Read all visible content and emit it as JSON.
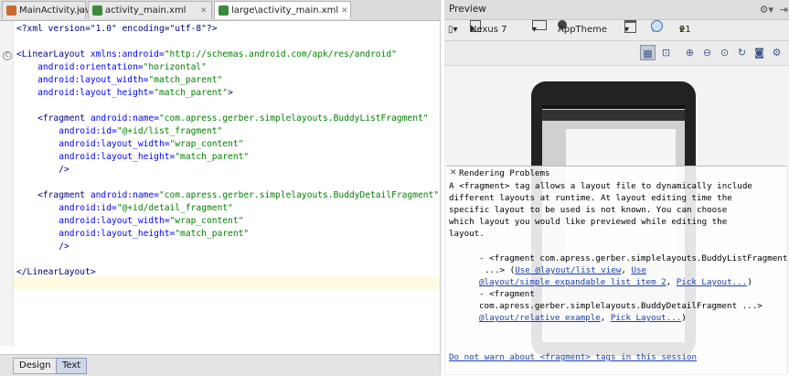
{
  "editor": {
    "tabs": [
      {
        "label": "MainActivity.java",
        "icon": "java-file-icon",
        "active": false
      },
      {
        "label": "activity_main.xml",
        "icon": "xml-file-icon",
        "active": false
      },
      {
        "label": "large\\activity_main.xml",
        "icon": "xml-file-icon",
        "active": true
      }
    ],
    "code": {
      "l1": "<?xml version=\"1.0\" encoding=\"utf-8\"?>",
      "l2a": "<LinearLayout ",
      "l2b": "xmlns:android=",
      "l2c": "\"http://schemas.android.com/apk/res/android\"",
      "l3a": "    android:orientation=",
      "l3b": "\"horizontal\"",
      "l4a": "    android:layout_width=",
      "l4b": "\"match_parent\"",
      "l5a": "    android:layout_height=",
      "l5b": "\"match_parent\"",
      "l5c": ">",
      "l6a": "    <fragment ",
      "l6b": "android:name=",
      "l6c": "\"com.apress.gerber.simplelayouts.BuddyListFragment\"",
      "l7a": "        android:id=",
      "l7b": "\"@+id/list_fragment\"",
      "l8a": "        android:layout_width=",
      "l8b": "\"wrap_content\"",
      "l9a": "        android:layout_height=",
      "l9b": "\"match_parent\"",
      "l10": "        />",
      "l11a": "    <fragment ",
      "l11b": "android:name=",
      "l11c": "\"com.apress.gerber.simplelayouts.BuddyDetailFragment\"",
      "l12a": "        android:id=",
      "l12b": "\"@+id/detail_fragment\"",
      "l13a": "        android:layout_width=",
      "l13b": "\"wrap_content\"",
      "l14a": "        android:layout_height=",
      "l14b": "\"match_parent\"",
      "l15": "        />",
      "l16": "</LinearLayout>"
    },
    "bottom_tabs": {
      "design": "Design",
      "text": "Text"
    }
  },
  "preview": {
    "title": "Preview",
    "toolbar": {
      "device": "Nexus 7",
      "orientation": "",
      "theme": "AppTheme",
      "api": "21"
    },
    "rendering": {
      "heading": "Rendering Problems",
      "p1": "A <fragment> tag allows a layout file to dynamically include",
      "p2": "different layouts at runtime. At layout editing time the",
      "p3": "specific layout to be used is not known. You can choose",
      "p4": "which layout you would like previewed while editing the",
      "p5": "layout.",
      "b1a": "- <fragment com.apress.gerber.simplelayouts.BuddyListFragment",
      "b1b": "...> (",
      "b1_link1": "Use @layout/list_view",
      "b1_sep": ", ",
      "b1_link2": "Use",
      "b1_link3": "@layout/simple_expandable_list_item_2",
      "b1_sep2": ", ",
      "b1_link4": "Pick Layout...",
      "b1_end": ")",
      "b2a": "- <fragment",
      "b2b": "com.apress.gerber.simplelayouts.BuddyDetailFragment ...>",
      "b2_open": "(",
      "b2_link1": "Use",
      "b2_link2": "@layout/relative_example",
      "b2_sep": ", ",
      "b2_link3": "Pick Layout...",
      "b2_end": ")",
      "footer": "Do not warn about <fragment> tags in this session"
    }
  },
  "colors": {
    "tag": "#000080",
    "attr": "#0000ff",
    "value": "#008000",
    "link": "#1a3fb0"
  }
}
